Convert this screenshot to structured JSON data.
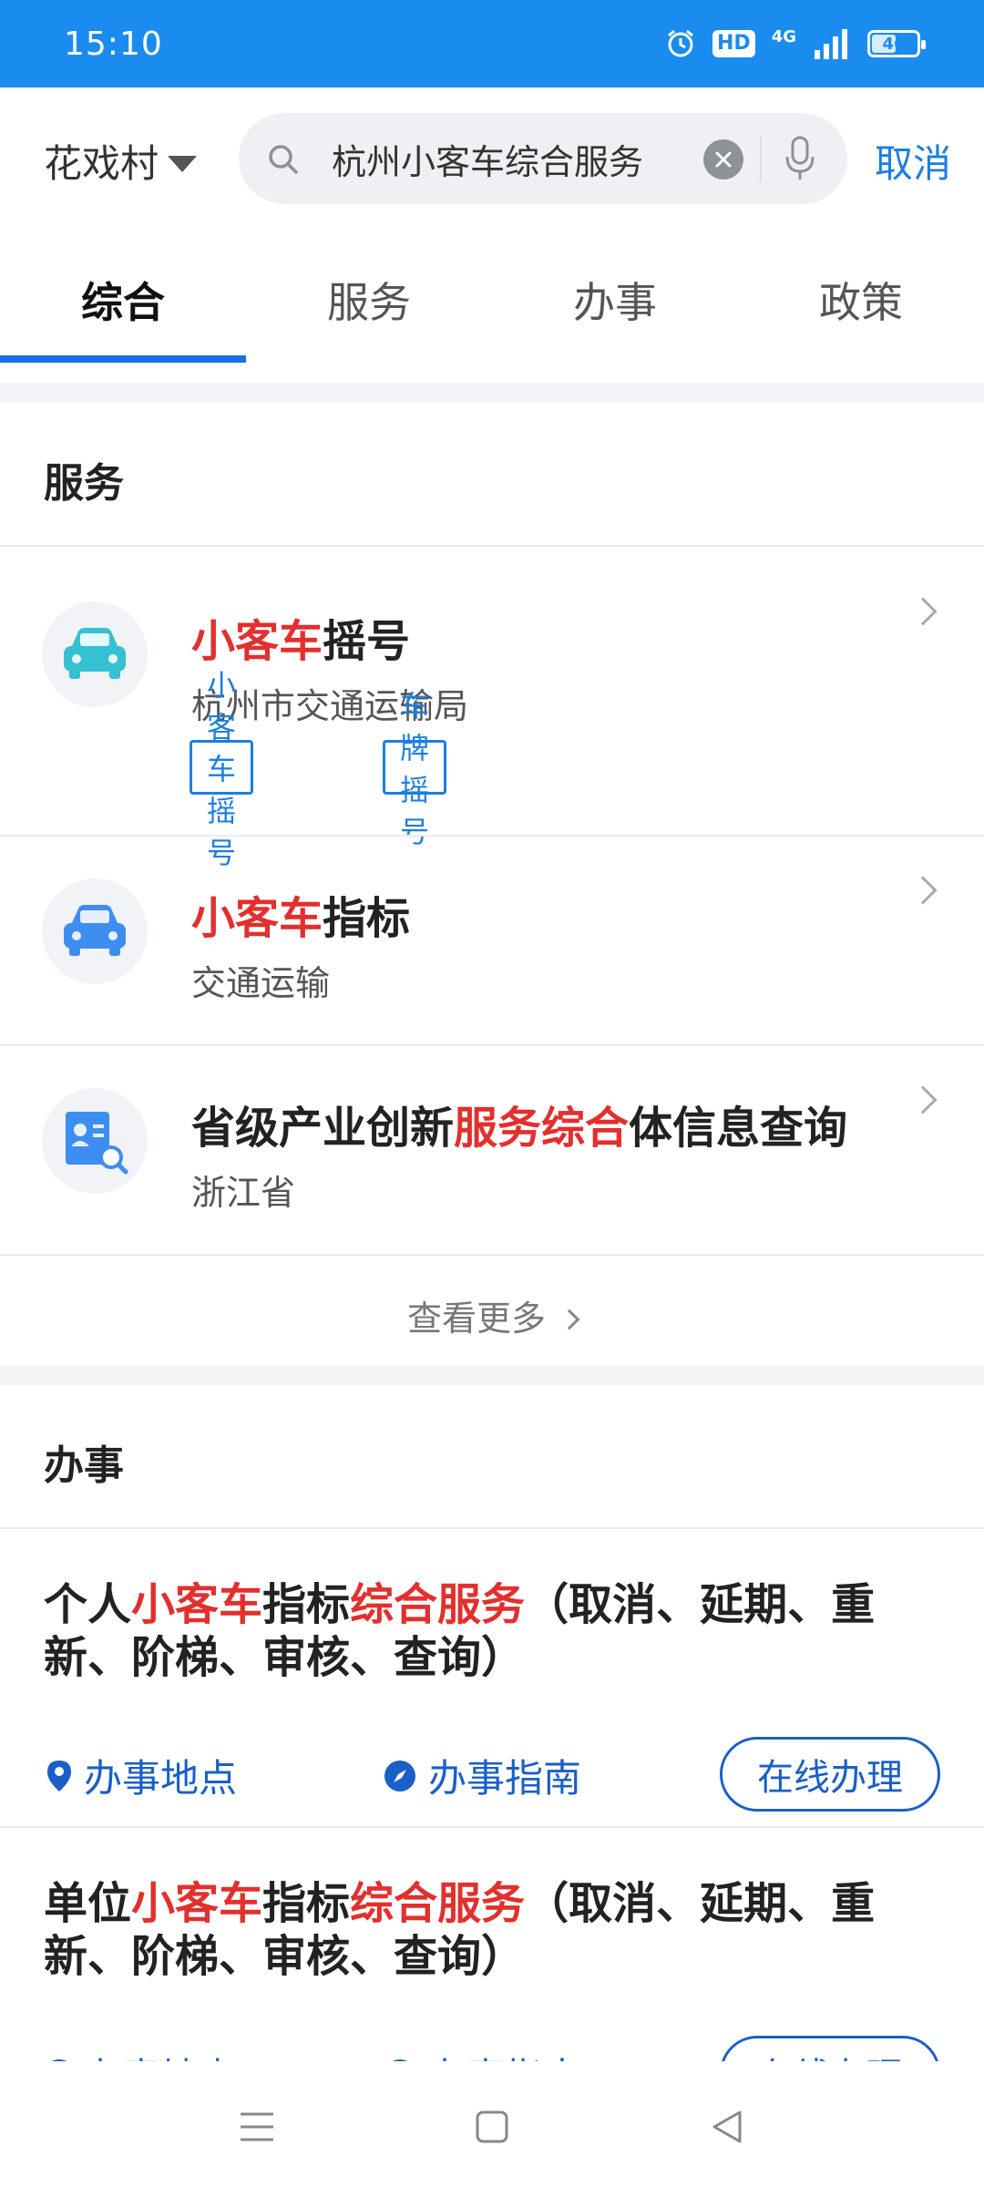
{
  "status": {
    "time": "15:10",
    "hd": "HD",
    "network": "4G",
    "battery": "46"
  },
  "search": {
    "city": "花戏村",
    "query": "杭州小客车综合服务",
    "cancel": "取消"
  },
  "tabs": [
    {
      "label": "综合",
      "active": true
    },
    {
      "label": "服务",
      "active": false
    },
    {
      "label": "办事",
      "active": false
    },
    {
      "label": "政策",
      "active": false
    }
  ],
  "services_section": {
    "title": "服务",
    "items": [
      {
        "hl": "小客车",
        "rest": "摇号",
        "pre": "",
        "sub": "杭州市交通运输局",
        "tags": [
          "小客车摇号",
          "车牌摇号"
        ],
        "icon": "car-icon"
      },
      {
        "hl": "小客车",
        "rest": "指标",
        "pre": "",
        "sub": "交通运输",
        "tags": [],
        "icon": "car-icon"
      },
      {
        "pre": "省级产业创新",
        "hl": "服务综合",
        "rest": "体信息查询",
        "sub": "浙江省",
        "tags": [],
        "icon": "id-card-search-icon"
      }
    ],
    "see_more": "查看更多"
  },
  "deals_section": {
    "title": "办事",
    "items": [
      {
        "pre": "个人",
        "hl1": "小客车",
        "mid": "指标",
        "hl2": "综合服务",
        "rest": "（取消、延期、重新、阶梯、审核、查询）"
      },
      {
        "pre": "单位",
        "hl1": "小客车",
        "mid": "指标",
        "hl2": "综合服务",
        "rest": "（取消、延期、重新、阶梯、审核、查询）"
      }
    ],
    "location_label": "办事地点",
    "guide_label": "办事指南",
    "online_label": "在线办理"
  },
  "colors": {
    "accent": "#1a8cf0",
    "highlight": "#e1302d",
    "link": "#1a5fc8"
  }
}
